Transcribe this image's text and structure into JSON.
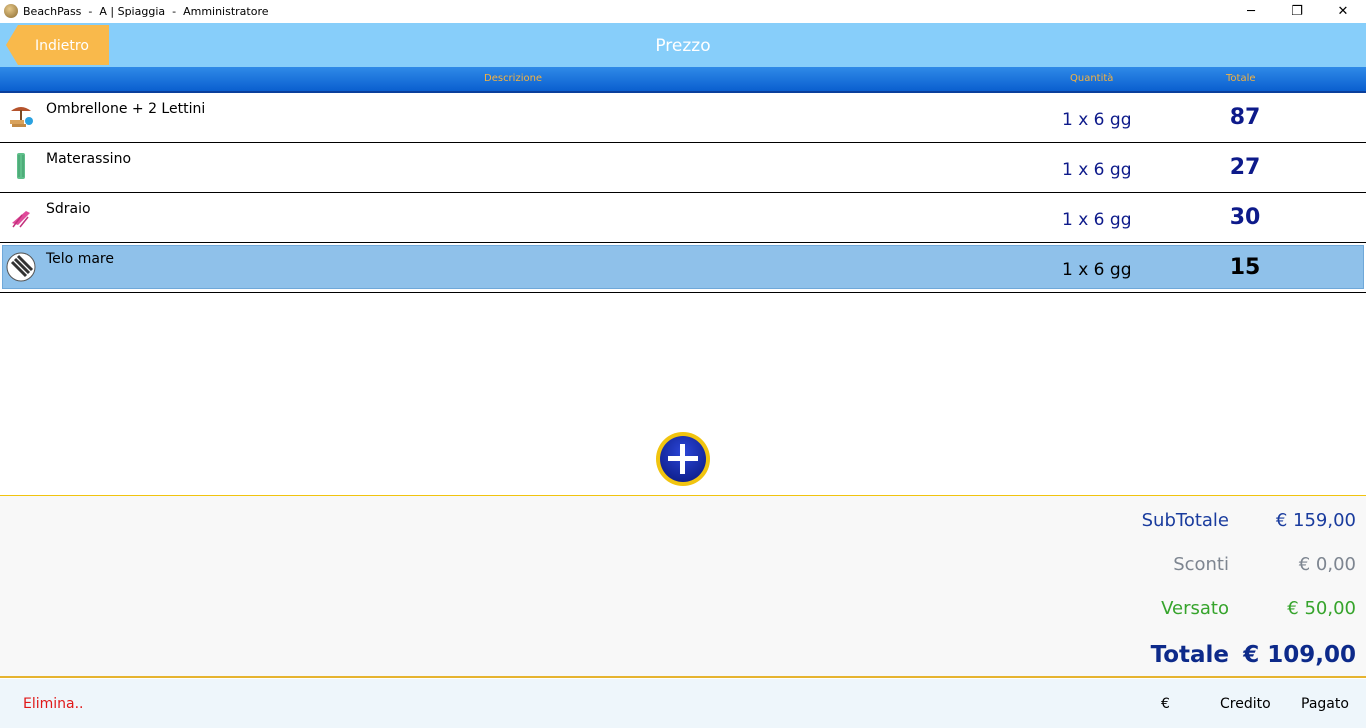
{
  "window": {
    "title": "BeachPass  -  A | Spiaggia  -  Amministratore",
    "minimize_icon": "─",
    "maximize_icon": "❐",
    "close_icon": "✕"
  },
  "header": {
    "back_label": "Indietro",
    "title": "Prezzo"
  },
  "columns": {
    "description": "Descrizione",
    "quantity": "Quantità",
    "total": "Totale"
  },
  "rows": [
    {
      "icon": "umbrella-loungers-icon",
      "description": "Ombrellone + 2 Lettini",
      "quantity": "1 x 6 gg",
      "total": "87"
    },
    {
      "icon": "air-mattress-icon",
      "description": "Materassino",
      "quantity": "1 x 6 gg",
      "total": "27"
    },
    {
      "icon": "deck-chair-icon",
      "description": "Sdraio",
      "quantity": "1 x 6 gg",
      "total": "30"
    },
    {
      "icon": "beach-towel-icon",
      "description": "Telo mare",
      "quantity": "1 x 6 gg",
      "total": "15",
      "selected": true
    }
  ],
  "summary": {
    "subtotal_label": "SubTotale",
    "subtotal_value": "€ 159,00",
    "discount_label": "Sconti",
    "discount_value": "€ 0,00",
    "paid_label": "Versato",
    "paid_value": "€ 50,00",
    "total_label": "Totale",
    "total_value": "€ 109,00"
  },
  "footer": {
    "delete_label": "Elimina..",
    "euro_label": "€",
    "credit_label": "Credito",
    "paid_label": "Pagato"
  },
  "colors": {
    "header_bg": "#87cefa",
    "back_button": "#f9b94b",
    "accent_yellow": "#f1c40f",
    "value_blue": "#0d1a8a",
    "delete_red": "#e01818",
    "paid_green": "#36a42c"
  }
}
